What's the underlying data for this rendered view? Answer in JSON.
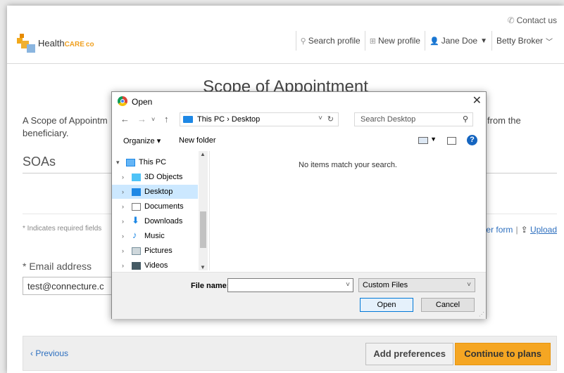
{
  "header": {
    "contact": "Contact us",
    "logo_main": "Health",
    "logo_caps": "CARE",
    "logo_co": "co",
    "nav": [
      {
        "label": "Search profile",
        "icon": "search-icon"
      },
      {
        "label": "New profile",
        "icon": "plus-box-icon"
      },
      {
        "label": "Jane Doe",
        "icon": "user-icon"
      },
      {
        "label": "Betty Broker",
        "icon": "chevron-down-icon"
      }
    ]
  },
  "main": {
    "title": "Scope of Appointment",
    "desc_left": "A Scope of Appointm",
    "desc_right": "from the",
    "desc_line2": "beneficiary.",
    "soas": "SOAs",
    "required_note": "* Indicates required fields",
    "links": {
      "form": "er form",
      "separator": "|",
      "upload": "Upload"
    },
    "email_label": "* Email address",
    "email_value": "test@connecture.c"
  },
  "footer": {
    "previous": "‹ Previous",
    "add_preferences": "Add preferences",
    "continue": "Continue to plans"
  },
  "dialog": {
    "title": "Open",
    "close": "✕",
    "path": "This PC  ›  Desktop",
    "search_placeholder": "Search Desktop",
    "organize": "Organize ▾",
    "new_folder": "New folder",
    "help": "?",
    "tree": [
      {
        "label": "This PC",
        "icon": "computer-icon",
        "expanded": true
      },
      {
        "label": "3D Objects",
        "icon": "cube-icon"
      },
      {
        "label": "Desktop",
        "icon": "desktop-icon",
        "selected": true
      },
      {
        "label": "Documents",
        "icon": "document-icon"
      },
      {
        "label": "Downloads",
        "icon": "download-icon"
      },
      {
        "label": "Music",
        "icon": "music-icon"
      },
      {
        "label": "Pictures",
        "icon": "pictures-icon"
      },
      {
        "label": "Videos",
        "icon": "video-icon"
      }
    ],
    "empty_message": "No items match your search.",
    "file_name_label": "File name:",
    "file_name_value": "",
    "file_type": "Custom Files",
    "open_button": "Open",
    "cancel_button": "Cancel"
  },
  "colors": {
    "accent_orange": "#f5a623",
    "link_blue": "#2d6fbf",
    "selection_blue": "#cce8ff"
  }
}
